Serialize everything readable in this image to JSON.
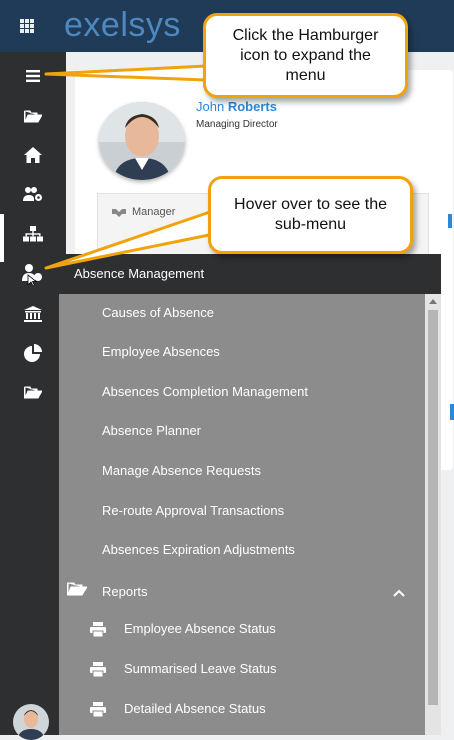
{
  "app": {
    "logo_text": "exelsys"
  },
  "profile": {
    "first_name": "John",
    "last_name": "Roberts",
    "role": "Managing Director"
  },
  "subcard": {
    "manager_label": "Manager"
  },
  "submenu": {
    "header": "Absence Management",
    "items": [
      {
        "label": "Causes of Absence"
      },
      {
        "label": "Employee Absences"
      },
      {
        "label": "Absences Completion Management"
      },
      {
        "label": "Absence Planner"
      },
      {
        "label": "Manage Absence Requests"
      },
      {
        "label": "Re-route Approval Transactions"
      },
      {
        "label": "Absences Expiration Adjustments"
      }
    ],
    "reports": {
      "label": "Reports",
      "expanded": true,
      "items": [
        {
          "label": "Employee Absence Status"
        },
        {
          "label": "Summarised Leave Status"
        },
        {
          "label": "Detailed Absence Status"
        }
      ]
    }
  },
  "callouts": {
    "hamburger": "Click the Hamburger icon to expand the menu",
    "hover": "Hover over to see the sub-menu"
  },
  "nav": {
    "icons": [
      "hamburger-icon",
      "folder-open-icon",
      "home-icon",
      "users-cog-icon",
      "sitemap-icon",
      "user-clock-icon",
      "bank-icon",
      "pie-chart-icon",
      "folder-icon"
    ],
    "active": "user-clock-icon"
  },
  "colors": {
    "topbar": "#1f3b57",
    "leftnav": "#2d2f31",
    "submenu": "#8c8c8c",
    "callout_border": "#f0a30a",
    "link_blue": "#2c88d9"
  }
}
